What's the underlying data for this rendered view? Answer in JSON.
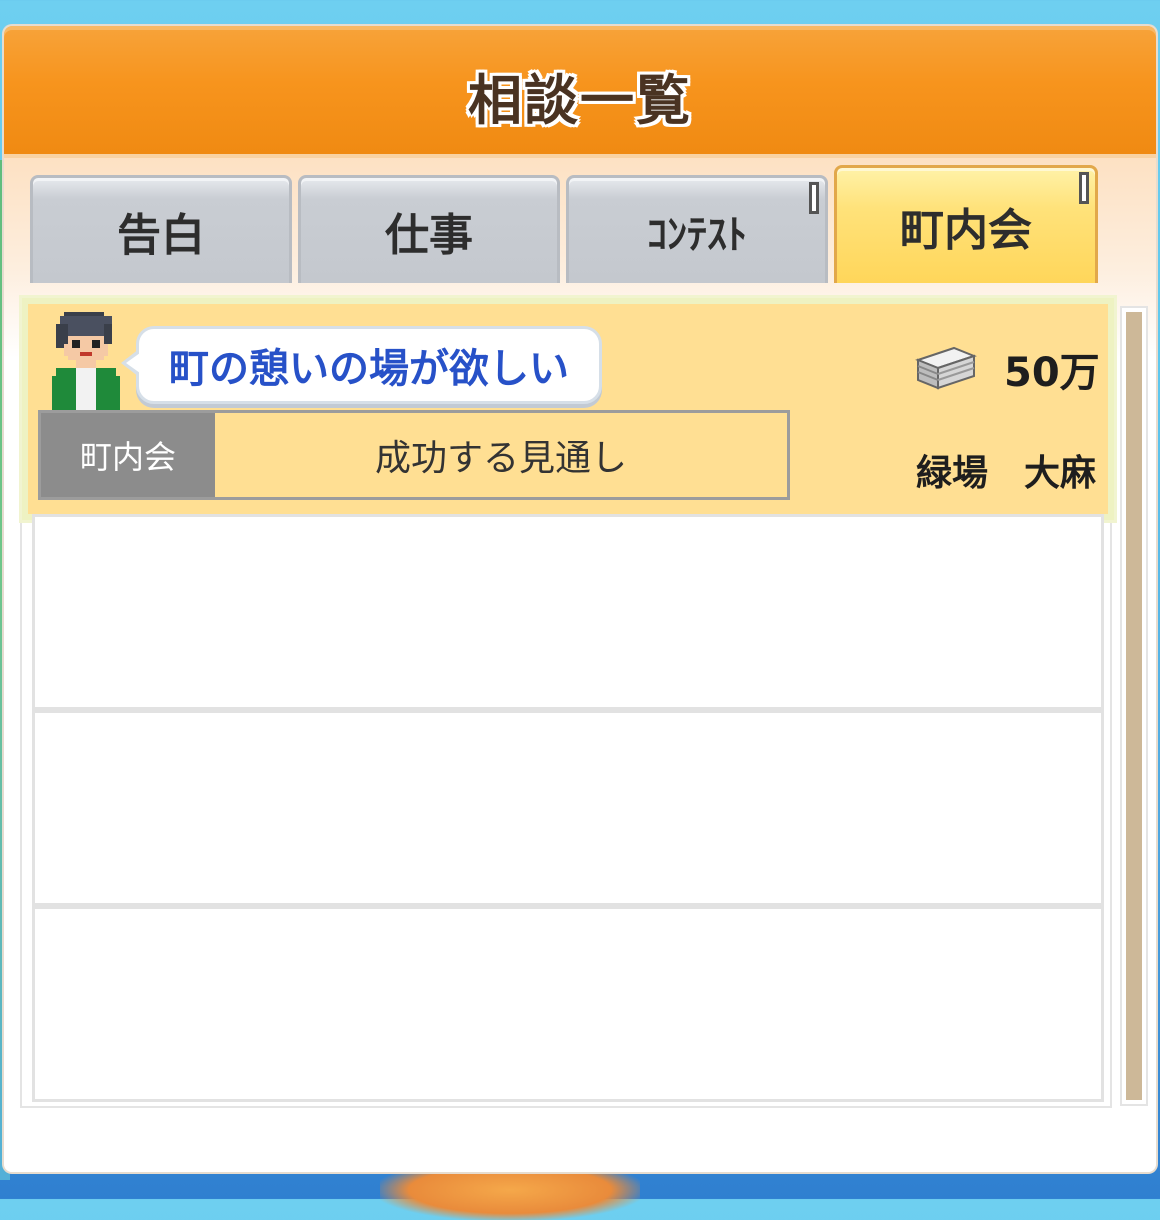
{
  "dialog": {
    "title": "相談一覧"
  },
  "tabs": [
    {
      "label": "告白",
      "active": false
    },
    {
      "label": "仕事",
      "active": false
    },
    {
      "label": "ｺﾝﾃｽﾄ",
      "active": false
    },
    {
      "label": "町内会",
      "active": true
    }
  ],
  "consultations": [
    {
      "request": "町の憩いの場が欲しい",
      "reward": "50万",
      "category": "町内会",
      "status": "成功する見通し",
      "client": "緑場　大麻"
    }
  ],
  "empty_row_count": 3,
  "colors": {
    "title_bar": "#f7941d",
    "active_tab": "#ffd65a",
    "selected_row": "#ffdf93",
    "request_text": "#2751c8",
    "category_badge": "#8c8c8c"
  },
  "icons": {
    "money": "money-stack-icon",
    "avatar": "villager-avatar-icon"
  }
}
